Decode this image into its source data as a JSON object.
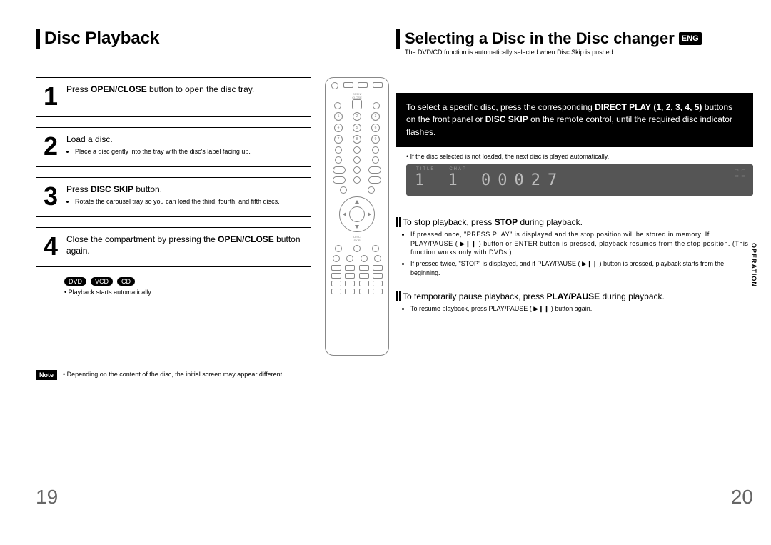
{
  "left": {
    "heading": "Disc Playback",
    "steps": [
      {
        "num": "1",
        "title_pre": "Press ",
        "title_bold": "OPEN/CLOSE",
        "title_post": " button to open the disc tray.",
        "bullets": []
      },
      {
        "num": "2",
        "title_pre": "",
        "title_bold": "",
        "title_post": "Load a disc.",
        "bullets": [
          "Place a disc gently into the tray with the disc's label facing up."
        ]
      },
      {
        "num": "3",
        "title_pre": "Press ",
        "title_bold": "DISC SKIP",
        "title_post": " button.",
        "bullets": [
          "Rotate the carousel tray so you can load the third, fourth, and fifth discs."
        ]
      },
      {
        "num": "4",
        "title_pre": "Close the compartment by pressing the ",
        "title_bold": "OPEN/CLOSE",
        "title_post": " button again.",
        "bullets": []
      }
    ],
    "badges": [
      "DVD",
      "VCD",
      "CD"
    ],
    "after_badge": "Playback starts automatically.",
    "note_label": "Note",
    "note_text": "Depending on the content of the disc, the initial screen may appear different.",
    "page_num": "19",
    "remote": {
      "open_close_label": "OPEN/\nCLOSE",
      "numpad": [
        "1",
        "2",
        "3",
        "4",
        "5",
        "6",
        "7",
        "8",
        "9"
      ],
      "disc_skip": "DISC\nSKIP"
    }
  },
  "right": {
    "heading": "Selecting a Disc in the Disc changer",
    "lang": "ENG",
    "subhead": "The DVD/CD function is automatically selected when Disc Skip is pushed.",
    "panel_line1_pre": "To select a specific disc, press the corresponding ",
    "panel_line1_bold": "DIRECT PLAY",
    "panel_line2_bold": "(1, 2, 3, 4, 5)",
    "panel_line2_mid": " buttons on the front panel or ",
    "panel_line2_bold2": "DISC SKIP",
    "panel_line2_post": " on the remote control, until the required disc indicator flashes.",
    "bullet_a": "If the disc selected is not loaded, the next disc is played automatically.",
    "display": {
      "title_label": "TITLE",
      "chap_label": "CHAP",
      "digits": "1   1  00027"
    },
    "stop_sec": {
      "head_pre": "To stop playback, press ",
      "head_bold": "STOP",
      "head_post": " during playback.",
      "b1": "If pressed once, \"PRESS PLAY\" is displayed and the stop position will be stored in memory. If PLAY/PAUSE ( ▶❙❙ ) button or ENTER button is pressed, playback resumes from the stop position. (This function works only with DVDs.)",
      "b2": "If pressed twice, \"STOP\" is displayed, and if PLAY/PAUSE ( ▶❙❙ ) button is pressed, playback starts from the beginning."
    },
    "pause_sec": {
      "head_pre": "To temporarily pause playback, press ",
      "head_bold": "PLAY/PAUSE",
      "head_post": " during playback.",
      "b1": "To resume playback, press PLAY/PAUSE ( ▶❙❙ ) button again."
    },
    "side_tab": "OPERATION",
    "page_num": "20"
  }
}
